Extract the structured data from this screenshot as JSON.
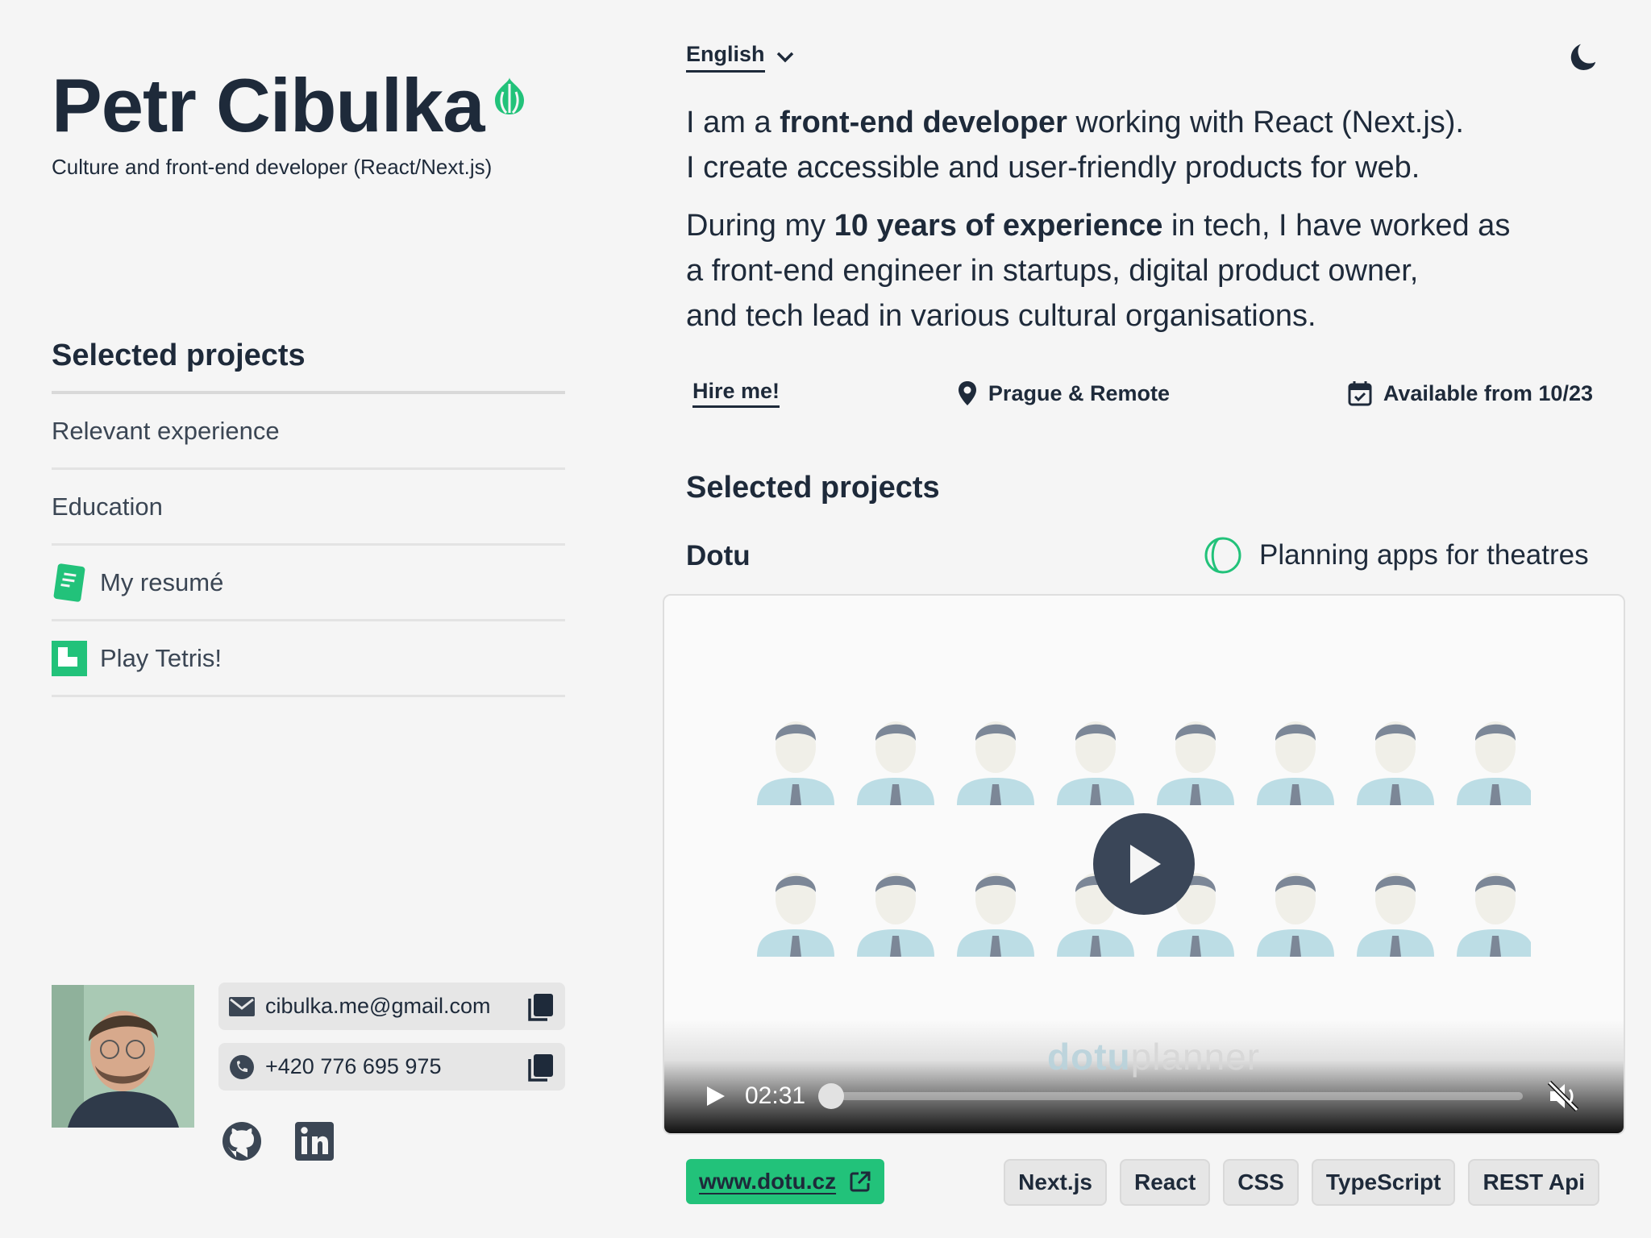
{
  "header": {
    "name": "Petr Cibulka",
    "subtitle": "Culture and front-end developer (React/Next.js)",
    "logo_icon": "onion-icon",
    "accent_color": "#22c27a"
  },
  "sidebar": {
    "heading": "Selected projects",
    "items": [
      {
        "label": "Relevant experience"
      },
      {
        "label": "Education"
      },
      {
        "label": "My resumé",
        "icon": "document-icon"
      },
      {
        "label": "Play Tetris!",
        "icon": "tetris-icon"
      }
    ]
  },
  "contacts": {
    "email": "cibulka.me@gmail.com",
    "phone": "+420 776 695 975",
    "social": [
      "github-icon",
      "linkedin-icon"
    ]
  },
  "topbar": {
    "language": "English",
    "theme_icon": "moon-icon"
  },
  "intro": {
    "p1_a": "I am a ",
    "p1_b": "front-end developer",
    "p1_c": " working with React (Next.js).",
    "p1_d": "I create accessible and user-friendly products for web.",
    "p2_a": "During my ",
    "p2_b": "10 years of experience",
    "p2_c": " in tech, I have worked as",
    "p2_d": "a front-end engineer in startups, digital product owner,",
    "p2_e": "and tech lead in various cultural organisations."
  },
  "facts": {
    "hire": "Hire me!",
    "location": "Prague & Remote",
    "availability": "Available from 10/23"
  },
  "projects": {
    "heading": "Selected projects",
    "current": {
      "name": "Dotu",
      "category": "Planning apps for theatres",
      "video": {
        "brand_a": "dotu",
        "brand_b": "planner",
        "time": "02:31",
        "progress": 0
      },
      "link": "www.dotu.cz",
      "tags": [
        "Next.js",
        "React",
        "CSS",
        "TypeScript",
        "REST Api"
      ]
    }
  }
}
